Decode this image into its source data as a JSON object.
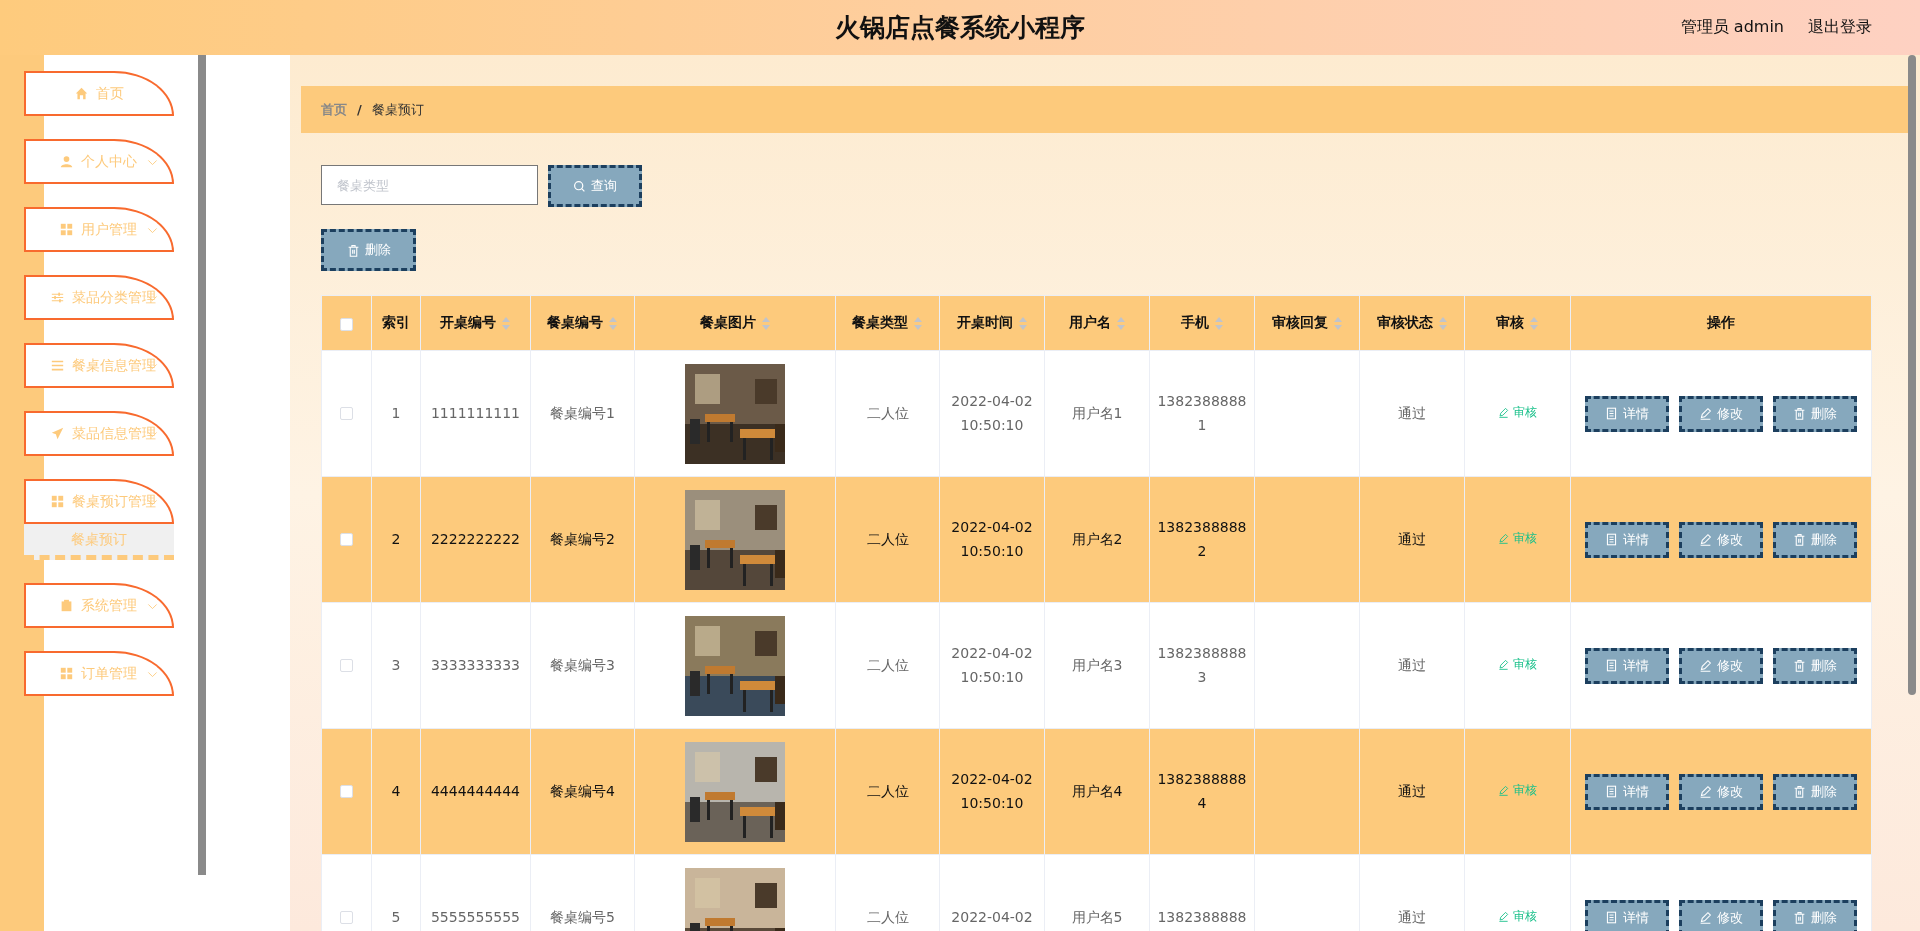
{
  "header": {
    "title": "火锅店点餐系统小程序",
    "user": "管理员 admin",
    "logout": "退出登录"
  },
  "sidebar": {
    "items": [
      {
        "label": "首页",
        "kind": "link"
      },
      {
        "label": "个人中心",
        "kind": "submenu"
      },
      {
        "label": "用户管理",
        "kind": "submenu"
      },
      {
        "label": "菜品分类管理",
        "kind": "submenu"
      },
      {
        "label": "餐桌信息管理",
        "kind": "submenu"
      },
      {
        "label": "菜品信息管理",
        "kind": "submenu"
      },
      {
        "label": "餐桌预订管理",
        "kind": "submenu",
        "children": [
          {
            "label": "餐桌预订",
            "selected": true
          }
        ]
      },
      {
        "label": "系统管理",
        "kind": "submenu"
      },
      {
        "label": "订单管理",
        "kind": "submenu"
      }
    ]
  },
  "breadcrumb": {
    "items": [
      "首页",
      "餐桌预订"
    ],
    "separator": "/"
  },
  "search": {
    "placeholder": "餐桌类型",
    "button": "查询"
  },
  "delete_button": "删除",
  "table": {
    "header_checked": false,
    "columns": [
      {
        "label": "索引",
        "sortable": false
      },
      {
        "label": "开桌编号",
        "sortable": true
      },
      {
        "label": "餐桌编号",
        "sortable": true
      },
      {
        "label": "餐桌图片",
        "sortable": true
      },
      {
        "label": "餐桌类型",
        "sortable": true
      },
      {
        "label": "开桌时间",
        "sortable": true
      },
      {
        "label": "用户名",
        "sortable": true
      },
      {
        "label": "手机",
        "sortable": true
      },
      {
        "label": "审核回复",
        "sortable": true
      },
      {
        "label": "审核状态",
        "sortable": true
      },
      {
        "label": "审核",
        "sortable": true
      },
      {
        "label": "操作",
        "sortable": false
      }
    ],
    "rows": [
      {
        "checked": false,
        "index": "1",
        "open_no": "1111111111",
        "table_no": "餐桌编号1",
        "type": "二人位",
        "time": "2022-04-02 10:50:10",
        "user": "用户名1",
        "phone": "13823888881",
        "status": "通过",
        "review": "审核",
        "actions": [
          "详情",
          "修改",
          "删除"
        ]
      },
      {
        "checked": false,
        "index": "2",
        "open_no": "2222222222",
        "table_no": "餐桌编号2",
        "type": "二人位",
        "time": "2022-04-02 10:50:10",
        "user": "用户名2",
        "phone": "13823888882",
        "status": "通过",
        "review": "审核",
        "actions": [
          "详情",
          "修改",
          "删除"
        ]
      },
      {
        "checked": false,
        "index": "3",
        "open_no": "3333333333",
        "table_no": "餐桌编号3",
        "type": "二人位",
        "time": "2022-04-02 10:50:10",
        "user": "用户名3",
        "phone": "13823888883",
        "status": "通过",
        "review": "审核",
        "actions": [
          "详情",
          "修改",
          "删除"
        ]
      },
      {
        "checked": false,
        "index": "4",
        "open_no": "4444444444",
        "table_no": "餐桌编号4",
        "type": "二人位",
        "time": "2022-04-02 10:50:10",
        "user": "用户名4",
        "phone": "13823888884",
        "status": "通过",
        "review": "审核",
        "actions": [
          "详情",
          "修改",
          "删除"
        ]
      },
      {
        "checked": false,
        "index": "5",
        "open_no": "5555555555",
        "table_no": "餐桌编号5",
        "type": "二人位",
        "time": "2022-04-02",
        "user": "用户名5",
        "phone": "1382388888",
        "status": "通过",
        "review": "审核",
        "actions": [
          "详情",
          "修改",
          "删除"
        ]
      }
    ]
  }
}
